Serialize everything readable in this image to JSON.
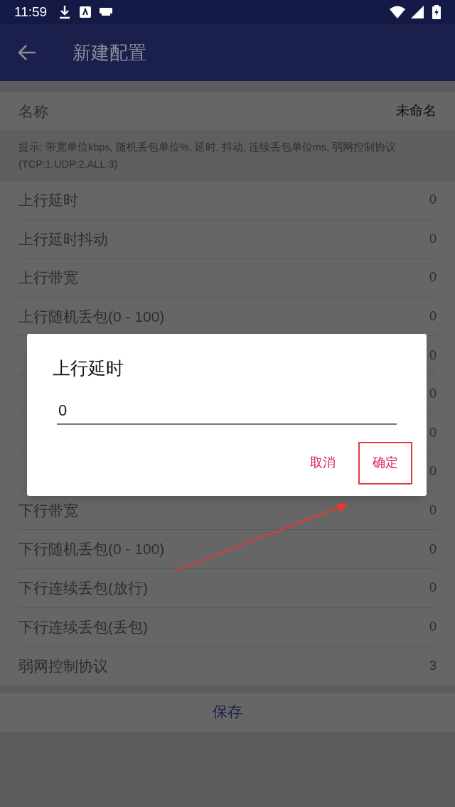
{
  "status_bar": {
    "time": "11:59"
  },
  "toolbar": {
    "title": "新建配置"
  },
  "name_row": {
    "label": "名称",
    "value": "未命名"
  },
  "hint": "提示: 带宽单位kbps, 随机丢包单位%, 延时, 抖动, 连续丢包单位ms, 弱网控制协议(TCP:1,UDP:2,ALL:3)",
  "rows": [
    {
      "label": "上行延时",
      "value": "0"
    },
    {
      "label": "上行延时抖动",
      "value": "0"
    },
    {
      "label": "上行带宽",
      "value": "0"
    },
    {
      "label": "上行随机丢包(0 - 100)",
      "value": "0"
    },
    {
      "value": "0"
    },
    {
      "value": "0"
    },
    {
      "value": "0"
    },
    {
      "value": "0"
    },
    {
      "label": "下行带宽",
      "value": "0"
    },
    {
      "label": "下行随机丢包(0 - 100)",
      "value": "0"
    },
    {
      "label": "下行连续丢包(放行)",
      "value": "0"
    },
    {
      "label": "下行连续丢包(丢包)",
      "value": "0"
    },
    {
      "label": "弱网控制协议",
      "value": "3"
    }
  ],
  "save_button": "保存",
  "dialog": {
    "title": "上行延时",
    "input": {
      "value": "0"
    },
    "buttons": [
      {
        "label": "取消",
        "highlighted": false
      },
      {
        "label": "确定",
        "highlighted": true
      }
    ]
  }
}
